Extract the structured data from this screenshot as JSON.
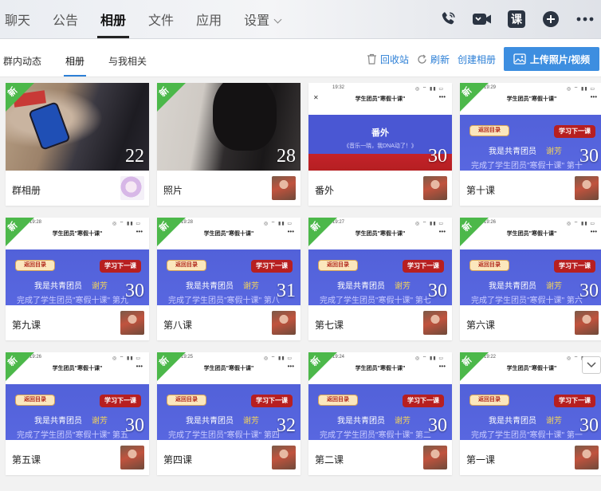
{
  "header": {
    "tabs": [
      {
        "label": "聊天",
        "active": false
      },
      {
        "label": "公告",
        "active": false
      },
      {
        "label": "相册",
        "active": true
      },
      {
        "label": "文件",
        "active": false
      },
      {
        "label": "应用",
        "active": false
      },
      {
        "label": "设置",
        "active": false
      }
    ],
    "icons": [
      "phone-icon",
      "video-call-icon",
      "class-icon",
      "add-icon",
      "more-icon"
    ],
    "class_icon_label": "课"
  },
  "subbar": {
    "tabs": [
      {
        "label": "群内动态",
        "active": false
      },
      {
        "label": "相册",
        "active": true
      },
      {
        "label": "与我相关",
        "active": false
      }
    ],
    "recycle": "回收站",
    "refresh": "刷新",
    "create": "创建相册",
    "upload": "上传照片/视频"
  },
  "colors": {
    "accent": "#2c7fd6",
    "new_badge": "#4cb84a",
    "upload_bg": "#3d8ee0"
  },
  "shot_text": {
    "title": "学生团员\"寒假十课\"",
    "back": "返回目录",
    "next": "学习下一课",
    "line1": "我是共青团员",
    "name": "谢芳",
    "fanwai_title": "番外",
    "fanwai_sub": "《音乐一晓，我DNA动了！》"
  },
  "albums": [
    {
      "name": "群相册",
      "count": "22",
      "new": true,
      "type": "photo1",
      "avatar": "pink"
    },
    {
      "name": "照片",
      "count": "28",
      "new": true,
      "type": "photo2",
      "avatar": "kid"
    },
    {
      "name": "番外",
      "count": "30",
      "new": false,
      "type": "fanwai",
      "time": "19:32",
      "avatar": "kid"
    },
    {
      "name": "第十课",
      "count": "30",
      "new": true,
      "type": "lesson",
      "time": "19:29",
      "line2": "完成了学生团员\"寒假十课\" 第十",
      "avatar": "kid"
    },
    {
      "name": "第九课",
      "count": "30",
      "new": true,
      "type": "lesson",
      "time": "19:28",
      "line2": "完成了学生团员\"寒假十课\" 第九",
      "avatar": "kid"
    },
    {
      "name": "第八课",
      "count": "31",
      "new": true,
      "type": "lesson",
      "time": "19:28",
      "line2": "完成了学生团员\"寒假十课\" 第八",
      "avatar": "kid"
    },
    {
      "name": "第七课",
      "count": "30",
      "new": true,
      "type": "lesson",
      "time": "19:27",
      "line2": "完成了学生团员\"寒假十课\" 第七",
      "avatar": "kid"
    },
    {
      "name": "第六课",
      "count": "30",
      "new": true,
      "type": "lesson",
      "time": "19:26",
      "line2": "完成了学生团员\"寒假十课\" 第六",
      "avatar": "kid"
    },
    {
      "name": "第五课",
      "count": "30",
      "new": true,
      "type": "lesson",
      "time": "19:26",
      "line2": "完成了学生团员\"寒假十课\" 第五",
      "avatar": "kid"
    },
    {
      "name": "第四课",
      "count": "32",
      "new": true,
      "type": "lesson",
      "time": "19:25",
      "line2": "完成了学生团员\"寒假十课\" 第四",
      "avatar": "kid"
    },
    {
      "name": "第二课",
      "count": "30",
      "new": true,
      "type": "lesson",
      "time": "19:24",
      "line2": "完成了学生团员\"寒假十课\" 第二",
      "avatar": "kid"
    },
    {
      "name": "第一课",
      "count": "30",
      "new": true,
      "type": "lesson",
      "time": "19:22",
      "line2": "完成了学生团员\"寒假十课\" 第一",
      "avatar": "kid"
    }
  ],
  "new_badge_label": "新"
}
